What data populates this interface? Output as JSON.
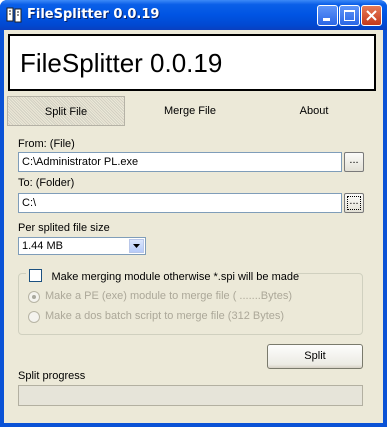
{
  "window": {
    "title": "FileSplitter 0.0.19"
  },
  "header": {
    "title": "FileSplitter 0.0.19"
  },
  "tabs": [
    {
      "label": "Split File",
      "active": true
    },
    {
      "label": "Merge File",
      "active": false
    },
    {
      "label": "About",
      "active": false
    }
  ],
  "from": {
    "label": "From: (File)",
    "value": "C:\\Administrator PL.exe",
    "browse_label": "..."
  },
  "to": {
    "label": "To: (Folder)",
    "value": "C:\\",
    "browse_label": "..."
  },
  "size": {
    "label": "Per splited file size",
    "selected": "1.44 MB"
  },
  "merge_module": {
    "checkbox_label": "Make merging module otherwise *.spi will be made",
    "checked": false,
    "options": [
      {
        "label": "Make a PE (exe) module to merge file ( .......Bytes)",
        "selected": true,
        "enabled": false
      },
      {
        "label": "Make a dos batch script to merge file (312 Bytes)",
        "selected": false,
        "enabled": false
      }
    ]
  },
  "split_button": {
    "label": "Split"
  },
  "progress": {
    "label": "Split progress",
    "value": 0
  },
  "colors": {
    "titlebar": "#0054e3",
    "client": "#ece9d8",
    "close_button": "#c4381b"
  },
  "icons": [
    "app-icon",
    "minimize-icon",
    "maximize-icon",
    "close-icon",
    "dropdown-arrow-icon"
  ]
}
